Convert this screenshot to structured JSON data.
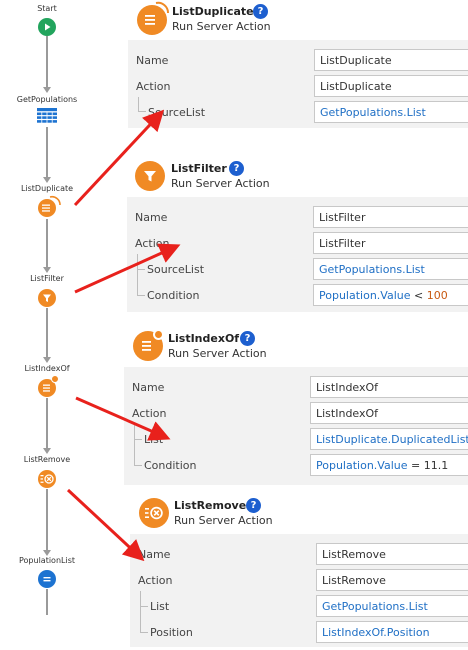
{
  "flow": {
    "nodes": [
      {
        "label": "Start",
        "icon": "play-icon"
      },
      {
        "label": "GetPopulations",
        "icon": "table-icon"
      },
      {
        "label": "ListDuplicate",
        "icon": "list-duplicate-icon"
      },
      {
        "label": "ListFilter",
        "icon": "funnel-icon"
      },
      {
        "label": "ListIndexOf",
        "icon": "list-index-icon"
      },
      {
        "label": "ListRemove",
        "icon": "list-remove-icon"
      },
      {
        "label": "PopulationList",
        "icon": "list-icon"
      }
    ]
  },
  "panels": [
    {
      "title": "ListDuplicate",
      "subtitle": "Run Server Action",
      "rows": [
        {
          "label": "Name",
          "value": "ListDuplicate"
        },
        {
          "label": "Action",
          "value": "ListDuplicate"
        },
        {
          "label": "SourceList",
          "value": "GetPopulations.List"
        }
      ]
    },
    {
      "title": "ListFilter",
      "subtitle": "Run Server Action",
      "rows": [
        {
          "label": "Name",
          "value": "ListFilter"
        },
        {
          "label": "Action",
          "value": "ListFilter"
        },
        {
          "label": "SourceList",
          "value": "GetPopulations.List"
        },
        {
          "label": "Condition",
          "value_expr": "Population.Value",
          "value_op": " < ",
          "value_num": "100"
        }
      ]
    },
    {
      "title": "ListIndexOf",
      "subtitle": "Run Server Action",
      "rows": [
        {
          "label": "Name",
          "value": "ListIndexOf"
        },
        {
          "label": "Action",
          "value": "ListIndexOf"
        },
        {
          "label": "List",
          "value": "ListDuplicate.DuplicatedList"
        },
        {
          "label": "Condition",
          "value_expr": "Population.Value",
          "value_op": " = ",
          "value_num": "11.1"
        }
      ]
    },
    {
      "title": "ListRemove",
      "subtitle": "Run Server Action",
      "rows": [
        {
          "label": "Name",
          "value": "ListRemove"
        },
        {
          "label": "Action",
          "value": "ListRemove"
        },
        {
          "label": "List",
          "value": "GetPopulations.List"
        },
        {
          "label": "Position",
          "value": "ListIndexOf.Position"
        }
      ]
    }
  ],
  "help_glyph": "?",
  "colors": {
    "orange": "#f08a24",
    "green": "#22a45d",
    "blue": "#1d73d1",
    "help_blue": "#1d5fcf",
    "expression": "#1f6fc5",
    "number": "#c85a13",
    "annotation_arrow": "#e8211c"
  }
}
